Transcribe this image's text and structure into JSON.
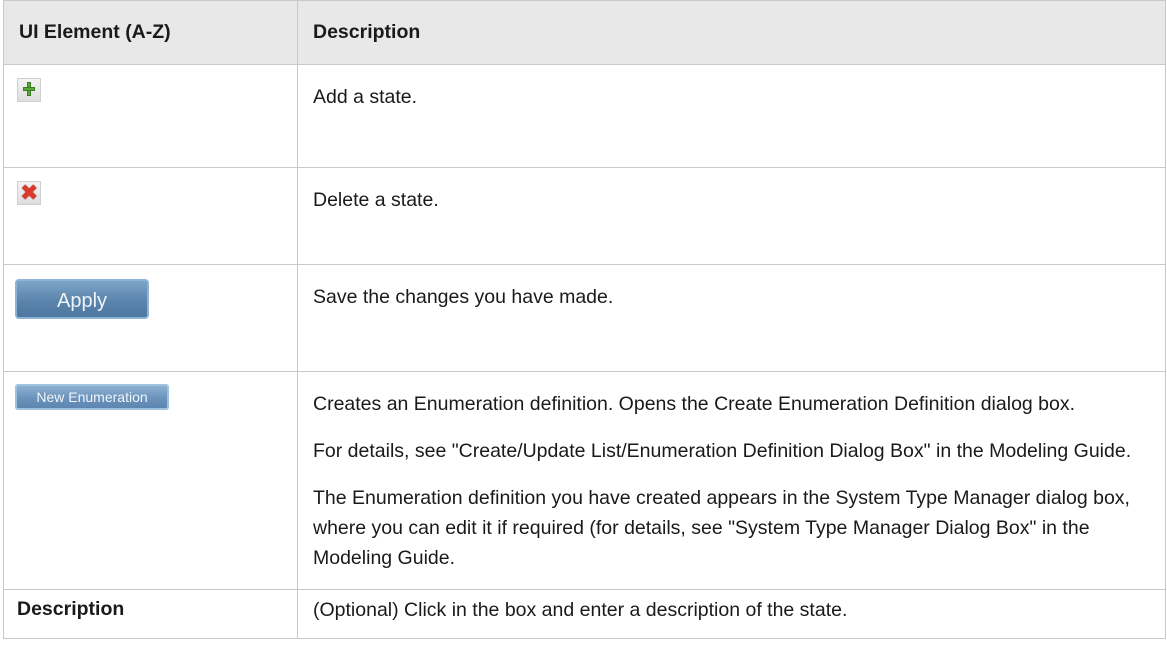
{
  "table": {
    "headers": {
      "element": "UI Element (A-Z)",
      "description": "Description"
    },
    "rows": [
      {
        "element_icon": "add-icon",
        "description": [
          "Add a state."
        ]
      },
      {
        "element_icon": "delete-icon",
        "element_glyph": "✖",
        "description": [
          "Delete a state."
        ]
      },
      {
        "element_button": "Apply",
        "description": [
          "Save the changes you have made."
        ]
      },
      {
        "element_button": "New Enumeration",
        "description": [
          "Creates an Enumeration definition. Opens the Create Enumeration Definition dialog box.",
          "For details, see \"Create/Update List/Enumeration Definition Dialog Box\" in the Modeling Guide.",
          "The Enumeration definition you have created appears in the System Type Manager dialog box, where you can edit it if required (for details, see \"System Type Manager Dialog Box\" in the Modeling Guide."
        ]
      },
      {
        "element_text": "Description",
        "description": [
          "(Optional) Click in the box and enter a description of the state."
        ]
      }
    ]
  },
  "colors": {
    "header_bg": "#e8e8e8",
    "border": "#c8c8c8",
    "button_blue": "#5c85ad",
    "add_green": "#5aa93a",
    "delete_red": "#d93a2b"
  }
}
